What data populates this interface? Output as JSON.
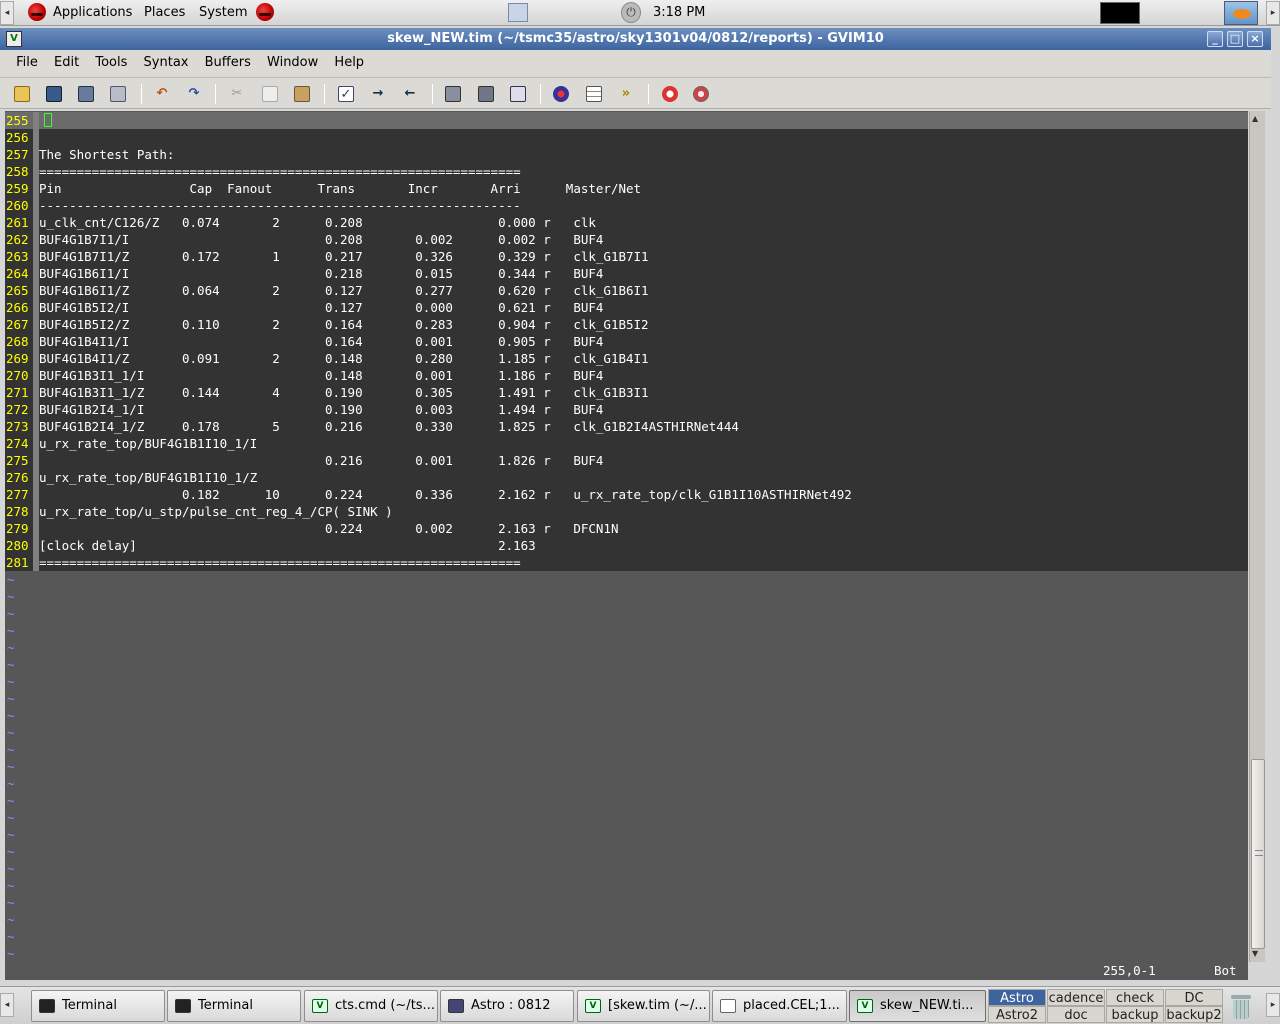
{
  "top_panel": {
    "menus": [
      "Applications",
      "Places",
      "System"
    ],
    "clock": "3:18 PM"
  },
  "window": {
    "title": "skew_NEW.tim (~/tsmc35/astro/sky1301v04/0812/reports) - GVIM10",
    "controls": [
      "_",
      "□",
      "×"
    ]
  },
  "menubar": {
    "items": [
      "File",
      "Edit",
      "Tools",
      "Syntax",
      "Buffers",
      "Window",
      "Help"
    ]
  },
  "toolbar": {
    "icons": [
      "open-icon",
      "save-icon",
      "save-all-icon",
      "print-icon",
      "undo-icon",
      "redo-icon",
      "cut-icon",
      "copy-icon",
      "paste-icon",
      "replace-icon",
      "find-next-icon",
      "find-prev-icon",
      "load-session-icon",
      "save-session-icon",
      "run-script-icon",
      "make-icon",
      "build-tags-icon",
      "jump-tag-icon",
      "help-icon",
      "find-help-icon"
    ]
  },
  "editor": {
    "lines": [
      {
        "n": "255",
        "t": ""
      },
      {
        "n": "256",
        "t": ""
      },
      {
        "n": "257",
        "t": "The Shortest Path:"
      },
      {
        "n": "258",
        "t": "================================================================"
      },
      {
        "n": "259",
        "t": "Pin                 Cap  Fanout      Trans       Incr       Arri      Master/Net"
      },
      {
        "n": "260",
        "t": "----------------------------------------------------------------"
      },
      {
        "n": "261",
        "t": "u_clk_cnt/C126/Z   0.074       2      0.208                  0.000 r   clk"
      },
      {
        "n": "262",
        "t": "BUF4G1B7I1/I                          0.208       0.002      0.002 r   BUF4"
      },
      {
        "n": "263",
        "t": "BUF4G1B7I1/Z       0.172       1      0.217       0.326      0.329 r   clk_G1B7I1"
      },
      {
        "n": "264",
        "t": "BUF4G1B6I1/I                          0.218       0.015      0.344 r   BUF4"
      },
      {
        "n": "265",
        "t": "BUF4G1B6I1/Z       0.064       2      0.127       0.277      0.620 r   clk_G1B6I1"
      },
      {
        "n": "266",
        "t": "BUF4G1B5I2/I                          0.127       0.000      0.621 r   BUF4"
      },
      {
        "n": "267",
        "t": "BUF4G1B5I2/Z       0.110       2      0.164       0.283      0.904 r   clk_G1B5I2"
      },
      {
        "n": "268",
        "t": "BUF4G1B4I1/I                          0.164       0.001      0.905 r   BUF4"
      },
      {
        "n": "269",
        "t": "BUF4G1B4I1/Z       0.091       2      0.148       0.280      1.185 r   clk_G1B4I1"
      },
      {
        "n": "270",
        "t": "BUF4G1B3I1_1/I                        0.148       0.001      1.186 r   BUF4"
      },
      {
        "n": "271",
        "t": "BUF4G1B3I1_1/Z     0.144       4      0.190       0.305      1.491 r   clk_G1B3I1"
      },
      {
        "n": "272",
        "t": "BUF4G1B2I4_1/I                        0.190       0.003      1.494 r   BUF4"
      },
      {
        "n": "273",
        "t": "BUF4G1B2I4_1/Z     0.178       5      0.216       0.330      1.825 r   clk_G1B2I4ASTHIRNet444"
      },
      {
        "n": "274",
        "t": "u_rx_rate_top/BUF4G1B1I10_1/I"
      },
      {
        "n": "275",
        "t": "                                      0.216       0.001      1.826 r   BUF4"
      },
      {
        "n": "276",
        "t": "u_rx_rate_top/BUF4G1B1I10_1/Z"
      },
      {
        "n": "277",
        "t": "                   0.182      10      0.224       0.336      2.162 r   u_rx_rate_top/clk_G1B1I10ASTHIRNet492"
      },
      {
        "n": "278",
        "t": "u_rx_rate_top/u_stp/pulse_cnt_reg_4_/CP( SINK )"
      },
      {
        "n": "279",
        "t": "                                      0.224       0.002      2.163 r   DFCN1N"
      },
      {
        "n": "280",
        "t": "[clock delay]                                                2.163"
      },
      {
        "n": "281",
        "t": "================================================================"
      }
    ],
    "tilde_count": 23,
    "tilde_char": "~"
  },
  "statusline": {
    "position": "255,0-1",
    "percent": "Bot"
  },
  "taskbar": {
    "tasks": [
      {
        "label": "Terminal",
        "icon": "terminal"
      },
      {
        "label": "Terminal",
        "icon": "terminal"
      },
      {
        "label": "cts.cmd (~/ts...",
        "icon": "vim"
      },
      {
        "label": "Astro : 0812",
        "icon": "astro"
      },
      {
        "label": "[skew.tim (~/...",
        "icon": "vim"
      },
      {
        "label": "placed.CEL;1...",
        "icon": "file"
      },
      {
        "label": "skew_NEW.ti...",
        "icon": "vim"
      }
    ],
    "workspaces": [
      "Astro",
      "cadence",
      "check",
      "DC",
      "Astro2",
      "doc",
      "backup",
      "backup2"
    ]
  },
  "colors": {
    "line_number": "#ffff00",
    "text": "#ffffff",
    "editor_bg": "#333333",
    "tilde": "#8a8aff",
    "cursor": "#33ff33",
    "titlebar": "#3e64a0"
  }
}
